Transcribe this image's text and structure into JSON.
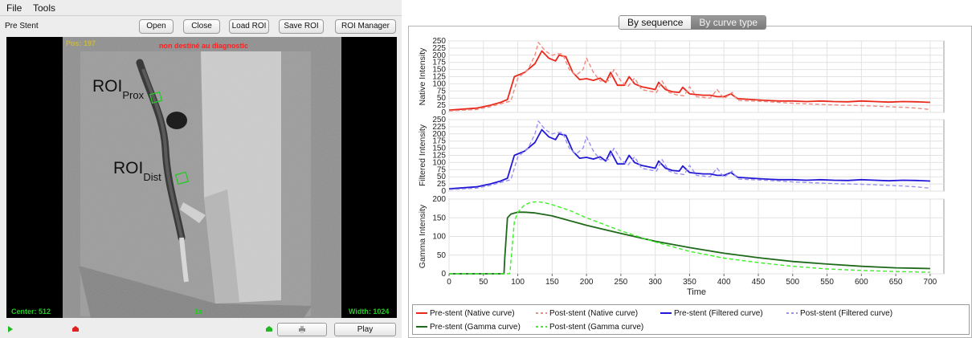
{
  "menubar": {
    "file": "File",
    "tools": "Tools"
  },
  "toolbar": {
    "title": "Pre Stent",
    "open": "Open",
    "close": "Close",
    "load_roi": "Load ROI",
    "save_roi": "Save ROI",
    "roi_manager": "ROI Manager"
  },
  "viewer": {
    "pos": "Pos: 197",
    "warning": "non destiné au diagnostic",
    "center": "Center: 512",
    "zoom": "1x",
    "width": "Width: 1024",
    "roi_prox": {
      "main": "ROI",
      "sub": "Prox"
    },
    "roi_dist": {
      "main": "ROI",
      "sub": "Dist"
    }
  },
  "bottombar": {
    "play": "Play"
  },
  "tabs": {
    "by_sequence": "By sequence",
    "by_curve_type": "By curve type",
    "active": "by_curve_type"
  },
  "colors": {
    "native_pre": "#e8291c",
    "native_post": "#f08a80",
    "filtered_pre": "#2318d6",
    "filtered_post": "#9a90f0",
    "gamma_pre": "#1f6a1a",
    "gamma_post": "#3ef02a"
  },
  "chart_data": {
    "type": "line",
    "xlabel": "Time",
    "xlim": [
      0,
      720
    ],
    "xticks": [
      0,
      50,
      100,
      150,
      200,
      250,
      300,
      350,
      400,
      450,
      500,
      550,
      600,
      650,
      700
    ],
    "subplots": [
      {
        "ylabel": "Native Intensity",
        "ylim": [
          0,
          250
        ],
        "yticks": [
          0,
          25,
          50,
          75,
          100,
          125,
          150,
          175,
          200,
          225,
          250
        ],
        "series": [
          {
            "name": "Pre-stent (Native curve)",
            "style": "solid",
            "color_key": "native_pre",
            "x": [
              0,
              40,
              60,
              75,
              85,
              95,
              110,
              125,
              135,
              145,
              155,
              160,
              170,
              180,
              190,
              200,
              210,
              220,
              228,
              235,
              245,
              255,
              262,
              270,
              280,
              290,
              300,
              305,
              315,
              325,
              335,
              340,
              350,
              360,
              370,
              380,
              390,
              400,
              410,
              420,
              440,
              460,
              480,
              500,
              520,
              540,
              560,
              580,
              600,
              620,
              640,
              660,
              680,
              700
            ],
            "y": [
              8,
              15,
              25,
              35,
              45,
              125,
              140,
              170,
              215,
              190,
              180,
              200,
              195,
              140,
              115,
              118,
              112,
              120,
              105,
              140,
              95,
              95,
              125,
              100,
              90,
              85,
              80,
              105,
              80,
              72,
              70,
              88,
              65,
              62,
              60,
              60,
              55,
              55,
              65,
              48,
              45,
              42,
              40,
              40,
              38,
              40,
              38,
              37,
              40,
              38,
              36,
              38,
              37,
              35
            ]
          },
          {
            "name": "Post-stent (Native curve)",
            "style": "dashed",
            "color_key": "native_post",
            "x": [
              0,
              40,
              60,
              75,
              90,
              100,
              115,
              125,
              130,
              140,
              150,
              158,
              165,
              175,
              185,
              195,
              200,
              210,
              220,
              232,
              240,
              250,
              260,
              270,
              280,
              290,
              302,
              310,
              320,
              330,
              342,
              350,
              360,
              372,
              380,
              390,
              400,
              412,
              420,
              440,
              460,
              480,
              500,
              520,
              540,
              560,
              580,
              600,
              620,
              640,
              660,
              680,
              700
            ],
            "y": [
              5,
              10,
              20,
              30,
              40,
              120,
              150,
              200,
              245,
              215,
              200,
              205,
              205,
              150,
              130,
              150,
              190,
              140,
              110,
              110,
              150,
              110,
              90,
              120,
              80,
              75,
              70,
              110,
              70,
              62,
              58,
              90,
              55,
              52,
              50,
              80,
              48,
              70,
              42,
              40,
              38,
              35,
              32,
              30,
              28,
              26,
              25,
              24,
              22,
              20,
              18,
              15,
              10
            ]
          }
        ]
      },
      {
        "ylabel": "Filtered Intensity",
        "ylim": [
          0,
          250
        ],
        "yticks": [
          0,
          25,
          50,
          75,
          100,
          125,
          150,
          175,
          200,
          225,
          250
        ],
        "series": [
          {
            "name": "Pre-stent (Filtered curve)",
            "style": "solid",
            "color_key": "filtered_pre",
            "x": [
              0,
              40,
              60,
              75,
              85,
              95,
              110,
              125,
              135,
              145,
              155,
              160,
              170,
              180,
              190,
              200,
              210,
              220,
              228,
              235,
              245,
              255,
              262,
              270,
              280,
              290,
              300,
              305,
              315,
              325,
              335,
              340,
              350,
              360,
              370,
              380,
              390,
              400,
              410,
              420,
              440,
              460,
              480,
              500,
              520,
              540,
              560,
              580,
              600,
              620,
              640,
              660,
              680,
              700
            ],
            "y": [
              8,
              15,
              25,
              35,
              45,
              125,
              140,
              170,
              215,
              190,
              180,
              200,
              195,
              140,
              115,
              118,
              112,
              120,
              105,
              140,
              95,
              95,
              125,
              100,
              90,
              85,
              80,
              105,
              80,
              72,
              70,
              88,
              65,
              62,
              60,
              60,
              55,
              55,
              65,
              48,
              45,
              42,
              40,
              40,
              38,
              40,
              38,
              37,
              40,
              38,
              36,
              38,
              37,
              35
            ]
          },
          {
            "name": "Post-stent (Filtered curve)",
            "style": "dashed",
            "color_key": "filtered_post",
            "x": [
              0,
              40,
              60,
              75,
              90,
              100,
              115,
              125,
              130,
              140,
              150,
              158,
              165,
              175,
              185,
              195,
              200,
              210,
              220,
              232,
              240,
              250,
              260,
              270,
              280,
              290,
              302,
              310,
              320,
              330,
              342,
              350,
              360,
              372,
              380,
              390,
              400,
              412,
              420,
              440,
              460,
              480,
              500,
              520,
              540,
              560,
              580,
              600,
              620,
              640,
              660,
              680,
              700
            ],
            "y": [
              5,
              10,
              20,
              30,
              40,
              120,
              150,
              200,
              245,
              215,
              200,
              205,
              205,
              150,
              130,
              150,
              190,
              140,
              110,
              110,
              150,
              110,
              90,
              120,
              80,
              75,
              70,
              110,
              70,
              62,
              58,
              90,
              55,
              52,
              50,
              80,
              48,
              70,
              42,
              40,
              38,
              35,
              32,
              30,
              28,
              26,
              25,
              24,
              22,
              20,
              18,
              15,
              10
            ]
          }
        ]
      },
      {
        "ylabel": "Gamma Intensity",
        "ylim": [
          0,
          200
        ],
        "yticks": [
          0,
          50,
          100,
          150,
          200
        ],
        "series": [
          {
            "name": "Pre-stent (Gamma curve)",
            "style": "solid",
            "color_key": "gamma_pre",
            "x": [
              0,
              80,
              81,
              85,
              90,
              100,
              110,
              125,
              150,
              200,
              250,
              300,
              350,
              400,
              450,
              500,
              550,
              600,
              650,
              700
            ],
            "y": [
              0,
              0,
              40,
              150,
              160,
              165,
              165,
              163,
              155,
              130,
              108,
              87,
              70,
              55,
              43,
              33,
              26,
              20,
              16,
              14
            ]
          },
          {
            "name": "Post-stent (Gamma curve)",
            "style": "dashed",
            "color_key": "gamma_post",
            "x": [
              0,
              88,
              89,
              95,
              100,
              110,
              120,
              130,
              140,
              150,
              175,
              200,
              250,
              300,
              350,
              400,
              450,
              500,
              550,
              600,
              650,
              700
            ],
            "y": [
              0,
              0,
              10,
              140,
              165,
              185,
              192,
              193,
              190,
              185,
              170,
              150,
              115,
              85,
              60,
              42,
              30,
              20,
              13,
              9,
              6,
              4
            ]
          }
        ]
      }
    ]
  }
}
